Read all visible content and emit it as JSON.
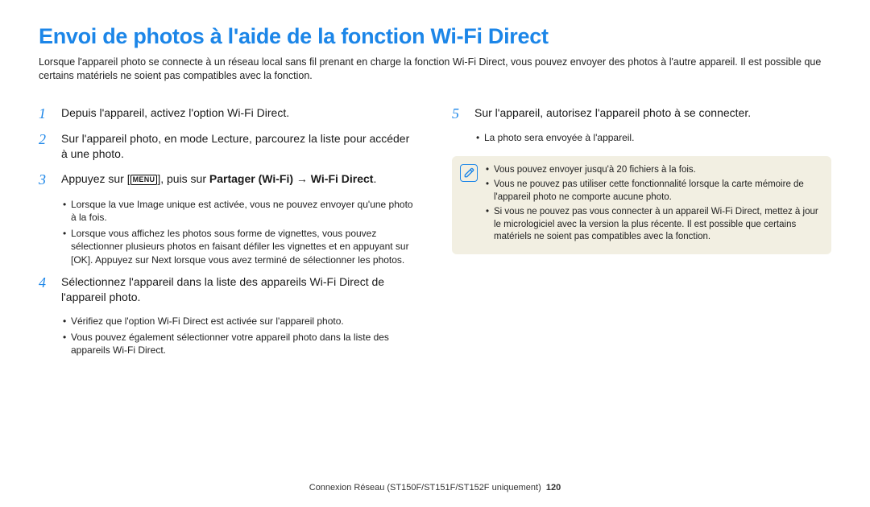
{
  "title": "Envoi de photos à l'aide de la fonction Wi-Fi Direct",
  "intro": "Lorsque l'appareil photo se connecte à un réseau local sans fil prenant en charge la fonction Wi-Fi Direct, vous pouvez envoyer des photos à l'autre appareil. Il est possible que certains matériels ne soient pas compatibles avec la fonction.",
  "steps": {
    "s1": "Depuis l'appareil, activez l'option Wi-Fi Direct.",
    "s2": "Sur l'appareil photo, en mode Lecture, parcourez la liste pour accéder à une photo.",
    "s3a": "Appuyez sur [",
    "s3b": "], puis sur ",
    "s3_bold1": "Partager (Wi-Fi)",
    "s3_arrow": " → ",
    "s3_bold2": "Wi-Fi Direct",
    "s3_dot": ".",
    "icon_menu": "MENU",
    "icon_ok": "OK",
    "s3_b1": "Lorsque la vue Image unique est activée, vous ne pouvez envoyer qu'une photo à la fois.",
    "s3_b2a": "Lorsque vous affichez les photos sous forme de vignettes, vous pouvez sélectionner plusieurs photos en faisant défiler les vignettes et en appuyant sur [",
    "s3_b2b": "]. Appuyez sur ",
    "s3_b2_bold": "Next",
    "s3_b2c": " lorsque vous avez terminé de sélectionner les photos.",
    "s4": "Sélectionnez l'appareil dans la liste des appareils Wi-Fi Direct de l'appareil photo.",
    "s4_b1": "Vérifiez que l'option Wi-Fi Direct est activée sur l'appareil photo.",
    "s4_b2": "Vous pouvez également sélectionner votre appareil photo dans la liste des appareils Wi-Fi Direct.",
    "s5": "Sur l'appareil, autorisez l'appareil photo à se connecter.",
    "s5_b1": "La photo sera envoyée à l'appareil."
  },
  "notes": {
    "n1": "Vous pouvez envoyer jusqu'à 20 fichiers à la fois.",
    "n2": "Vous ne pouvez pas utiliser cette fonctionnalité lorsque la carte mémoire de l'appareil photo ne comporte aucune photo.",
    "n3": "Si vous ne pouvez pas vous connecter à un appareil Wi-Fi Direct, mettez à jour le micrologiciel avec la version la plus récente. Il est possible que certains matériels ne soient pas compatibles avec la fonction."
  },
  "footer": {
    "text": "Connexion Réseau (ST150F/ST151F/ST152F uniquement)",
    "page": "120"
  }
}
